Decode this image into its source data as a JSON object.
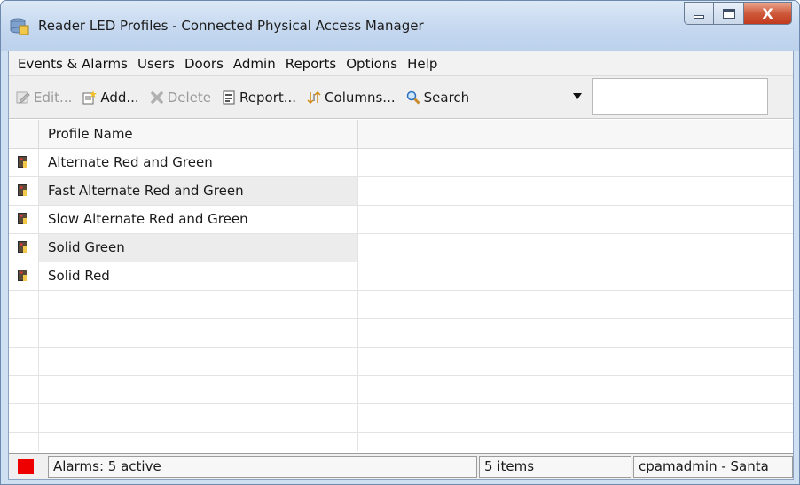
{
  "window": {
    "title": "Reader LED Profiles - Connected Physical Access Manager",
    "close_glyph": "X"
  },
  "menubar": {
    "items": [
      "Events & Alarms",
      "Users",
      "Doors",
      "Admin",
      "Reports",
      "Options",
      "Help"
    ]
  },
  "toolbar": {
    "edit_label": "Edit...",
    "add_label": "Add...",
    "delete_label": "Delete",
    "report_label": "Report...",
    "columns_label": "Columns...",
    "search_label": "Search",
    "search_value": ""
  },
  "table": {
    "columns": [
      "Profile Name"
    ],
    "rows": [
      "Alternate Red and Green",
      "Fast Alternate Red and Green",
      "Slow Alternate Red and Green",
      "Solid Green",
      "Solid Red"
    ]
  },
  "status": {
    "alarms": "Alarms: 5 active",
    "items": "5 items",
    "user": "cpamadmin - Santa"
  },
  "colors": {
    "alarm_led": "#ee0000",
    "titlebar": "#c4d7ef",
    "close_button": "#c0391d"
  }
}
